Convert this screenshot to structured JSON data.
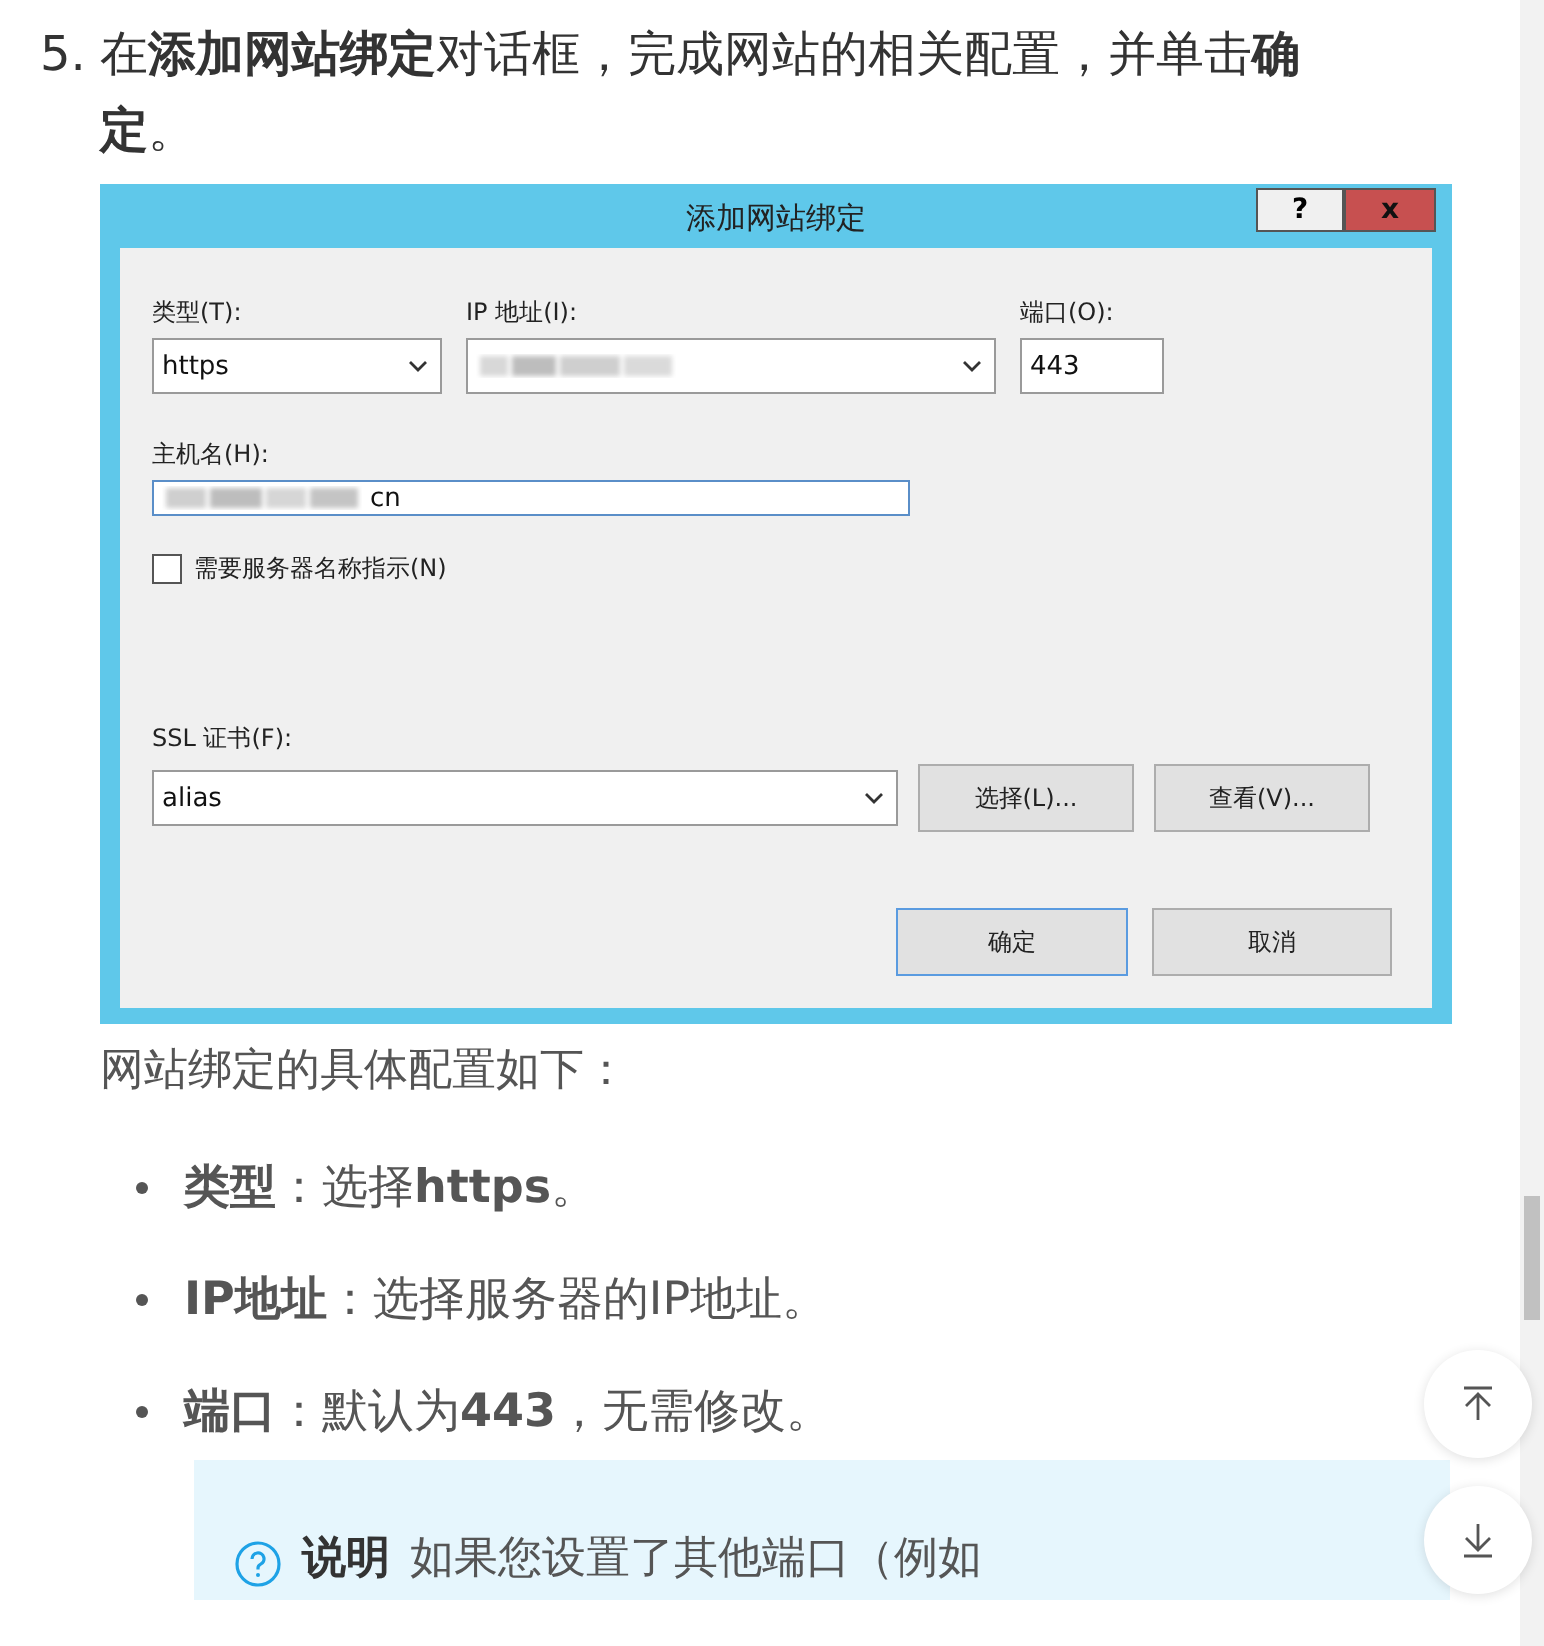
{
  "step": {
    "number": "5.",
    "text": "在**添加网站绑定**对话框，完成网站的相关配置，并单击**确定**。"
  },
  "dialog": {
    "title": "添加网站绑定",
    "help_button": "?",
    "close_button": "x",
    "type_field": {
      "label": "类型(T):",
      "value": "https"
    },
    "ip_field": {
      "label": "IP 地址(I):",
      "redacted": true
    },
    "port_field": {
      "label": "端口(O):",
      "value": "443"
    },
    "host_field": {
      "label": "主机名(H):",
      "value": "cn",
      "redacted": true,
      "focused": true
    },
    "sni_checkbox": {
      "label": "需要服务器名称指示(N)",
      "checked": false
    },
    "ssl_field": {
      "label": "SSL 证书(F):",
      "value": "alias"
    },
    "ssl_buttons": [
      "选择(L)...",
      "查看(V)..."
    ],
    "footer_buttons": [
      {
        "label": "确定",
        "default": true
      },
      {
        "label": "取消",
        "default": false
      }
    ]
  },
  "intro": "网站绑定的具体配置如下：",
  "bullets": [
    "**类型**：选择**https**。",
    "**IP地址**：选择服务器的IP地址。",
    "**端口**：默认为**443**，无需修改。"
  ],
  "note": {
    "title": "说明",
    "text": "如果您设置了其他端口（例如"
  },
  "float_buttons": [
    {
      "kind": "top"
    },
    {
      "kind": "down"
    }
  ]
}
